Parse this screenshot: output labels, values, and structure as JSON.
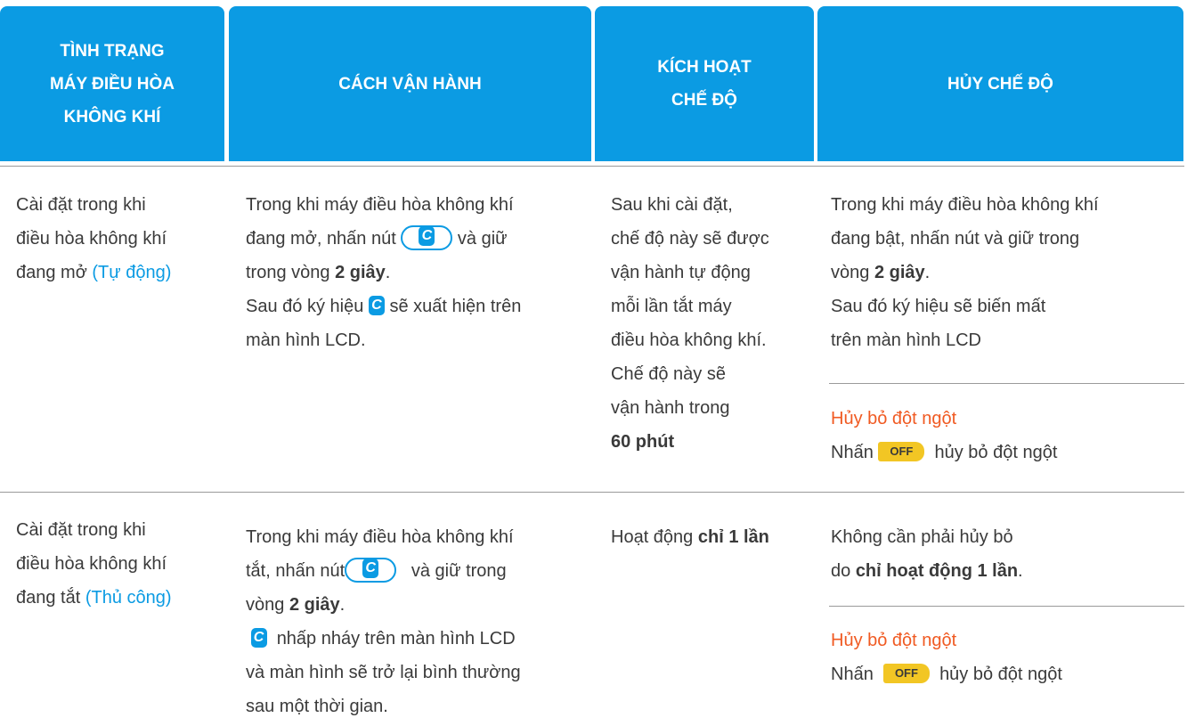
{
  "header": {
    "col1": [
      "TÌNH TRẠNG",
      "MÁY ĐIỀU HÒA",
      "KHÔNG KHÍ"
    ],
    "col2": [
      "CÁCH VẬN HÀNH"
    ],
    "col3": [
      "KÍCH HOẠT",
      "CHẾ ĐỘ"
    ],
    "col4": [
      "HỦY CHẾ ĐỘ"
    ]
  },
  "icons": {
    "c_symbol": "C",
    "off_label": "OFF",
    "accent_color": "#0b9be3",
    "header_color": "#0b9be3",
    "highlight_color": "#f05a22",
    "off_button_color": "#f2c624"
  },
  "row1": {
    "status": {
      "line1": "Cài đặt trong khi",
      "line2": "điều hòa không khí",
      "line3_pre": "đang mở ",
      "line3_link": "(Tự động)"
    },
    "operation": {
      "line1": "Trong khi máy điều hòa không khí",
      "line2_pre": "đang mở, nhấn nút",
      "line2_post": "và giữ",
      "line3_pre": "trong vòng ",
      "line3_bold": "2 giây",
      "line3_post": ".",
      "line4_pre": "Sau đó ký hiệu",
      "line4_post": "sẽ xuất hiện trên",
      "line5": "màn hình LCD."
    },
    "activate": {
      "line1": "Sau khi cài đặt,",
      "line2": "chế độ này sẽ được",
      "line3": "vận hành tự động",
      "line4": "mỗi lần tắt máy",
      "line5": "điều hòa không khí.",
      "line6": "Chế độ này sẽ",
      "line7": "vận hành trong",
      "line8_bold": "60 phút"
    },
    "cancel": {
      "line1": "Trong khi máy điều hòa không khí",
      "line2": "đang bật, nhấn nút và giữ trong",
      "line3_pre": "vòng ",
      "line3_bold": "2 giây",
      "line3_post": ".",
      "line4": "Sau đó ký hiệu sẽ biến mất",
      "line5": "trên màn hình LCD",
      "abrupt_title": "Hủy bỏ đột ngột",
      "abrupt_pre": "Nhấn",
      "abrupt_post": "hủy bỏ đột ngột"
    }
  },
  "row2": {
    "status": {
      "line1": "Cài đặt trong khi",
      "line2": "điều hòa không khí",
      "line3_pre": "đang tắt ",
      "line3_link": "(Thủ công)"
    },
    "operation": {
      "line1": "Trong khi máy điều hòa không khí",
      "line2_pre": "tắt, nhấn nút",
      "line2_post": "và giữ trong",
      "line3_pre": "vòng ",
      "line3_bold": "2 giây",
      "line3_post": ".",
      "line4_post": "nhấp nháy trên màn hình LCD",
      "line5": "và màn hình sẽ trở lại bình thường",
      "line6": "sau một thời gian."
    },
    "activate": {
      "pre": "Hoạt động ",
      "bold": "chỉ 1 lần"
    },
    "cancel": {
      "line1": "Không cần phải hủy bỏ",
      "line2_pre": "do ",
      "line2_bold": "chỉ hoạt động 1 lần",
      "line2_post": ".",
      "abrupt_title": "Hủy bỏ đột ngột",
      "abrupt_pre": "Nhấn",
      "abrupt_post": "hủy bỏ đột ngột"
    }
  }
}
